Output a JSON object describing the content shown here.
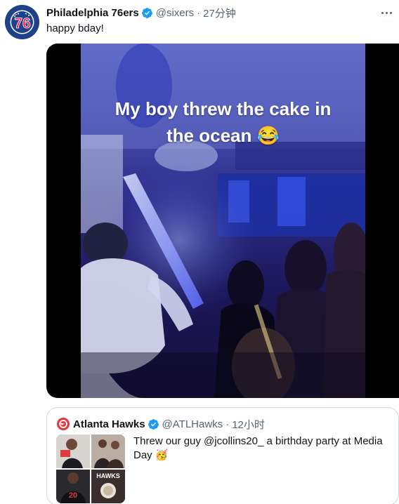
{
  "tweet": {
    "author_name": "Philadelphia 76ers",
    "handle": "@sixers",
    "separator": "·",
    "time": "27分钟",
    "text": "happy bday!",
    "avatar_text": "76"
  },
  "media": {
    "caption_line1": "My boy threw the cake in",
    "caption_line2": "the ocean 😂"
  },
  "quoted_tweet": {
    "author_name": "Atlanta Hawks",
    "handle": "@ATLHawks",
    "separator": "·",
    "time": "12小时",
    "text": "Threw our guy @jcollins20_ a birthday party at Media Day 🥳"
  },
  "colors": {
    "sixers_blue": "#1d428a",
    "sixers_red": "#ed174c",
    "verified_blue": "#1d9bf0",
    "hawks_red": "#e03a3e",
    "secondary_text": "#536471"
  }
}
